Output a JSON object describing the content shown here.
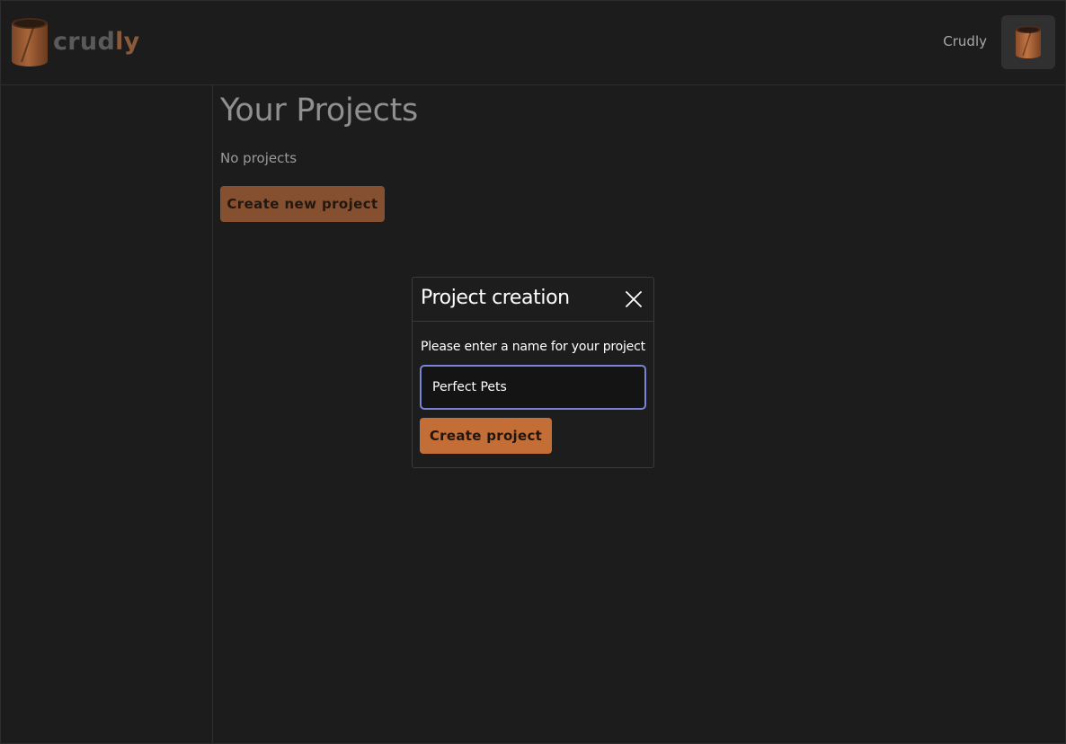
{
  "header": {
    "logo_text_main": "crud",
    "logo_text_accent": "ly",
    "logo_icon": "cylinder-logo-icon",
    "user_name": "Crudly",
    "avatar_icon": "cylinder-avatar-icon"
  },
  "main": {
    "title": "Your Projects",
    "empty_text": "No projects",
    "create_button_label": "Create new project"
  },
  "modal": {
    "title": "Project creation",
    "close_icon": "close-icon",
    "label": "Please enter a name for your project",
    "input_value": "Perfect Pets",
    "submit_label": "Create project"
  },
  "colors": {
    "background": "#1c1c1c",
    "accent": "#c46e37",
    "accent_dim": "#84502f",
    "focus_ring": "#7b83d6"
  }
}
